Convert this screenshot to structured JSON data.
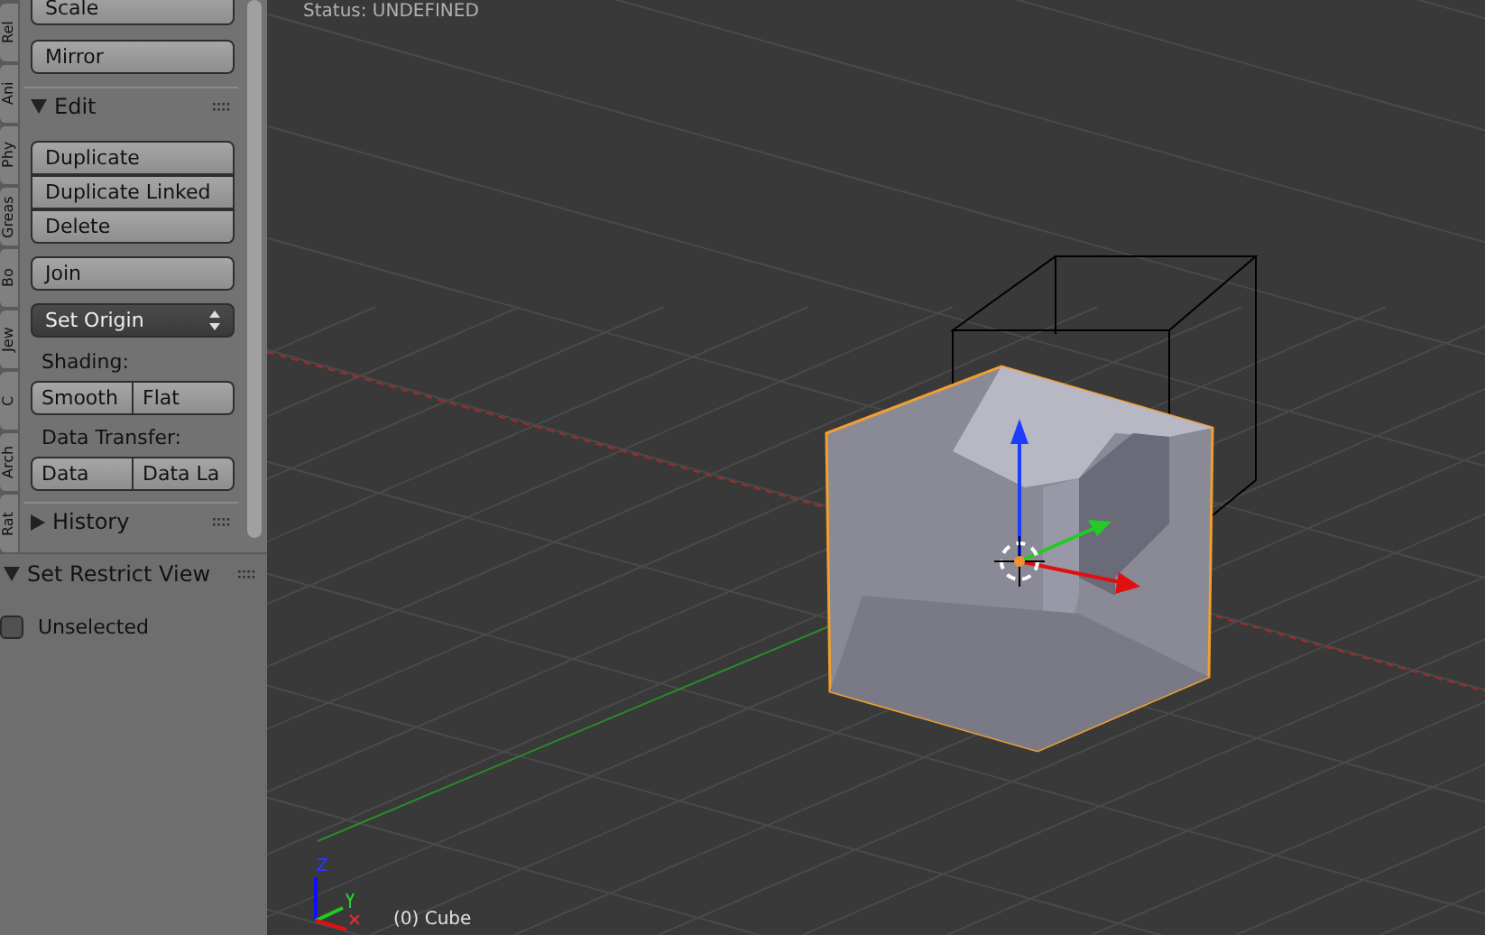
{
  "tabs": [
    {
      "label": "Rel",
      "selected": false
    },
    {
      "label": "Ani",
      "selected": false
    },
    {
      "label": "Phy",
      "selected": false
    },
    {
      "label": "Greas",
      "selected": false
    },
    {
      "label": "Bo",
      "selected": false
    },
    {
      "label": "Jew",
      "selected": false
    },
    {
      "label": "C",
      "selected": false
    },
    {
      "label": "Arch",
      "selected": false
    },
    {
      "label": "Rat",
      "selected": false
    }
  ],
  "tool_panel": [
    {
      "kind": "button",
      "label": "Scale"
    },
    {
      "kind": "button",
      "label": "Mirror"
    },
    {
      "kind": "header",
      "label": "Edit",
      "expanded": true
    },
    {
      "kind": "stack",
      "buttons": [
        "Duplicate",
        "Duplicate Linked",
        "Delete"
      ]
    },
    {
      "kind": "button",
      "label": "Join"
    },
    {
      "kind": "dropdown",
      "label": "Set Origin"
    },
    {
      "kind": "label",
      "label": "Shading:"
    },
    {
      "kind": "row",
      "buttons": [
        "Smooth",
        "Flat"
      ]
    },
    {
      "kind": "label",
      "label": "Data Transfer:"
    },
    {
      "kind": "row",
      "buttons": [
        "Data",
        "Data La"
      ]
    },
    {
      "kind": "header",
      "label": "History",
      "expanded": false
    }
  ],
  "operator_panel": {
    "title": "Set Restrict View",
    "expanded": true,
    "options": [
      {
        "label": "Unselected",
        "checked": false
      }
    ]
  },
  "viewport": {
    "status_text": "Status: UNDEFINED",
    "object_label": "(0) Cube"
  }
}
